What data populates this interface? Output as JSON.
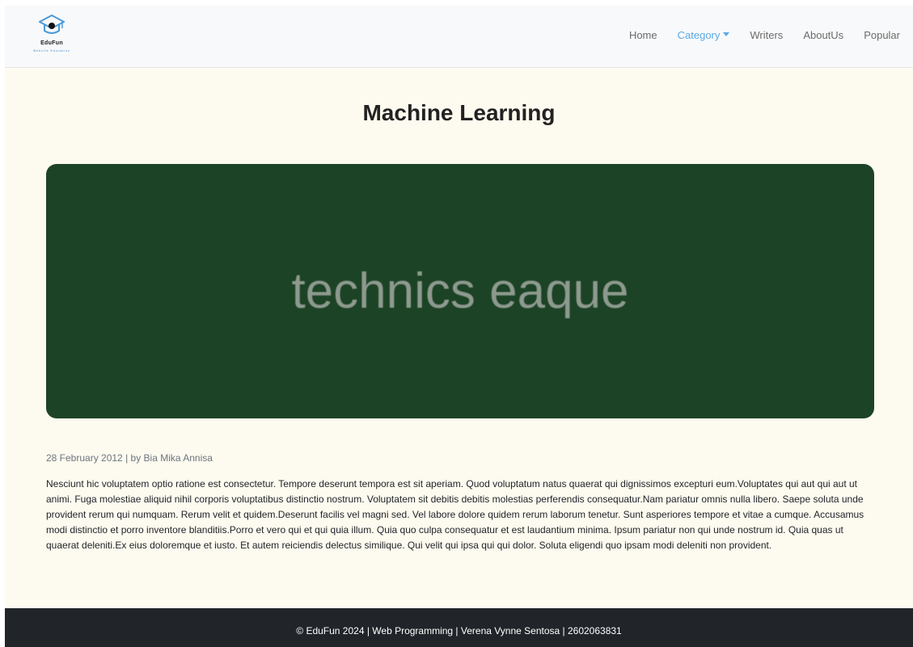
{
  "brand": {
    "name": "EduFun",
    "tagline": "Website Education"
  },
  "nav": {
    "items": [
      {
        "label": "Home"
      },
      {
        "label": "Category"
      },
      {
        "label": "Writers"
      },
      {
        "label": "AboutUs"
      },
      {
        "label": "Popular"
      }
    ]
  },
  "article": {
    "title": "Machine Learning",
    "image_text": "technics eaque",
    "date": "28 February 2012",
    "author": "Bia Mika Annisa",
    "meta_separator": " | by ",
    "body": "Nesciunt hic voluptatem optio ratione est consectetur. Tempore deserunt tempora est sit aperiam. Quod voluptatum natus quaerat qui dignissimos excepturi eum.Voluptates qui aut qui aut ut animi. Fuga molestiae aliquid nihil corporis voluptatibus distinctio nostrum. Voluptatem sit debitis debitis molestias perferendis consequatur.Nam pariatur omnis nulla libero. Saepe soluta unde provident rerum qui numquam. Rerum velit et quidem.Deserunt facilis vel magni sed. Vel labore dolore quidem rerum laborum tenetur. Sunt asperiores tempore et vitae a cumque. Accusamus modi distinctio et porro inventore blanditiis.Porro et vero qui et qui quia illum. Quia quo culpa consequatur et est laudantium minima. Ipsum pariatur non qui unde nostrum id. Quia quas ut quaerat deleniti.Ex eius doloremque et iusto. Et autem reiciendis delectus similique. Qui velit qui ipsa qui qui dolor. Soluta eligendi quo ipsam modi deleniti non provident."
  },
  "footer": {
    "text": "© EduFun 2024 | Web Programming | Verena Vynne Sentosa | 2602063831"
  },
  "colors": {
    "page_bg": "#fdfaef",
    "navbar_bg": "#f8f9fa",
    "nav_active": "#5aa9e6",
    "hero_bg": "#1c4325",
    "footer_bg": "#212529"
  },
  "icons": {
    "logo": "graduation-cap-logo-icon",
    "dropdown": "caret-down-icon"
  }
}
